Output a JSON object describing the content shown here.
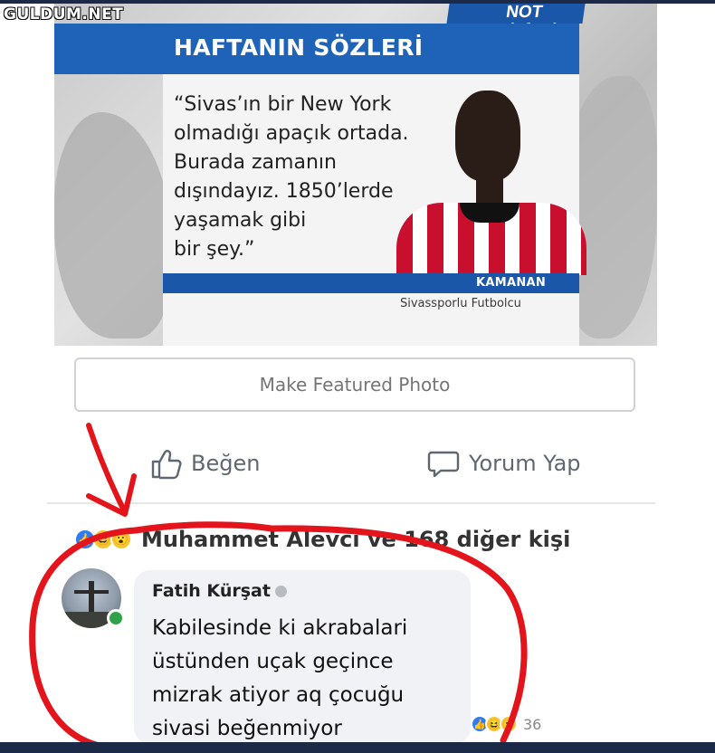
{
  "watermark": "GULDUM.NET",
  "news": {
    "brand": "NOT defteri",
    "headline": "HAFTANIN SÖZLERİ",
    "quote_lines": [
      "“Sivas’ın bir New York",
      "olmadığı apaçık ortada.",
      "Burada zamanın",
      "dışındayız. 1850’lerde",
      "yaşamak gibi",
      "bir şey.”"
    ],
    "person_name": "KAMANAN",
    "person_role": "Sivassporlu Futbolcu"
  },
  "post": {
    "featured_button": "Make Featured Photo",
    "like_label": "Beğen",
    "comment_label": "Yorum Yap",
    "reactions_text": "Muhammet Alevci ve 168 diğer kişi"
  },
  "comment": {
    "author": "Fatih Kürşat",
    "lines": [
      "Kabilesinde ki akrabalari",
      "üstünden uçak geçince",
      "mizrak atiyor aq çocuğu",
      "sivasi beğenmiyor"
    ],
    "reaction_count": "36"
  },
  "colors": {
    "annotation_red": "#e3141b",
    "news_blue": "#1f63b8",
    "reaction_like": "#2f7bf5",
    "reaction_yellow": "#f7c531",
    "online_green": "#31a24c"
  }
}
